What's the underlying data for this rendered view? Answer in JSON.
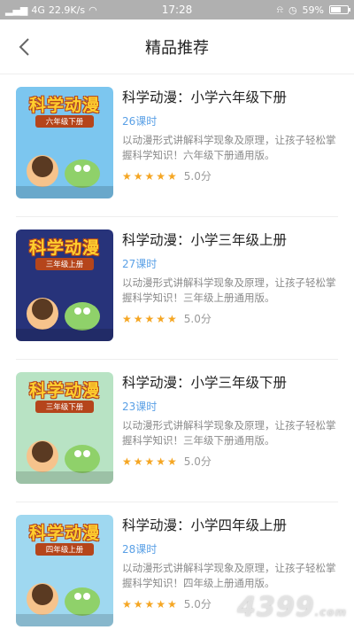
{
  "status_bar": {
    "signal_text": "4G",
    "speed": "22.9K/s",
    "time": "17:28",
    "battery_percent": "59%",
    "battery_level": 0.59
  },
  "nav": {
    "title": "精品推荐"
  },
  "courses": [
    {
      "title": "科学动漫：小学六年级下册",
      "lessons": "26课时",
      "desc": "以动漫形式讲解科学现象及原理，让孩子轻松掌握科学知识！六年级下册通用版。",
      "score": "5.0分",
      "stars": "★★★★★",
      "cover_title": "科学动漫",
      "cover_sub": "六年级下册",
      "cover_bg": "#7cc6ef"
    },
    {
      "title": "科学动漫：小学三年级上册",
      "lessons": "27课时",
      "desc": "以动漫形式讲解科学现象及原理，让孩子轻松掌握科学知识！三年级上册通用版。",
      "score": "5.0分",
      "stars": "★★★★★",
      "cover_title": "科学动漫",
      "cover_sub": "三年级上册",
      "cover_bg": "#27337a"
    },
    {
      "title": "科学动漫：小学三年级下册",
      "lessons": "23课时",
      "desc": "以动漫形式讲解科学现象及原理，让孩子轻松掌握科学知识！三年级下册通用版。",
      "score": "5.0分",
      "stars": "★★★★★",
      "cover_title": "科学动漫",
      "cover_sub": "三年级下册",
      "cover_bg": "#b8e3c4"
    },
    {
      "title": "科学动漫：小学四年级上册",
      "lessons": "28课时",
      "desc": "以动漫形式讲解科学现象及原理，让孩子轻松掌握科学知识！四年级上册通用版。",
      "score": "5.0分",
      "stars": "★★★★★",
      "cover_title": "科学动漫",
      "cover_sub": "四年级上册",
      "cover_bg": "#9fd8f0"
    }
  ],
  "watermark": "4399",
  "watermark_suffix": ".com",
  "colors": {
    "accent": "#5aa0e6",
    "star": "#f5a623"
  }
}
